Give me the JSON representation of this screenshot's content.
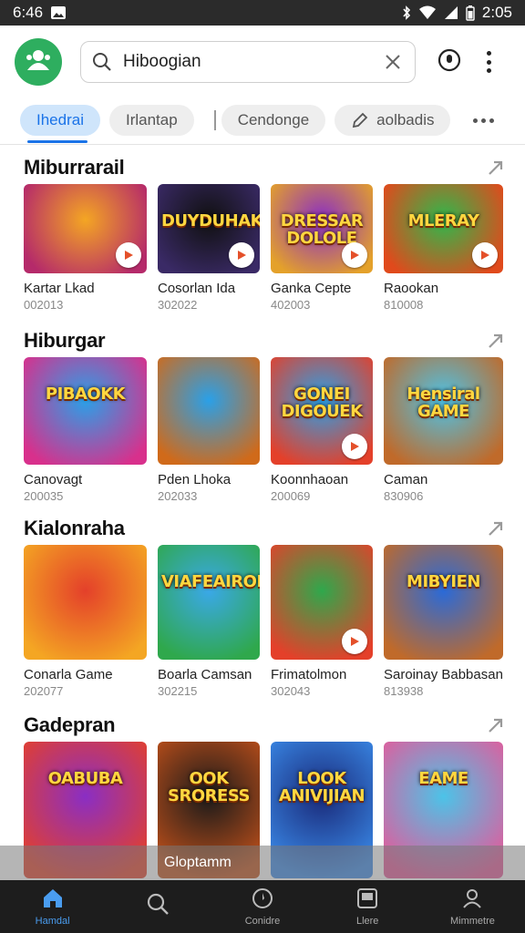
{
  "status": {
    "time_left": "6:46",
    "time_right": "2:05"
  },
  "search": {
    "value": "Hiboogian"
  },
  "chips": [
    {
      "label": "Ihedrai"
    },
    {
      "label": "Irlantap"
    },
    {
      "label": "Cendonge"
    },
    {
      "label": "aolbadis"
    }
  ],
  "sections": [
    {
      "title": "Miburrarail",
      "cards": [
        {
          "title": "Kartar Lkad",
          "sub": "002013",
          "art": "",
          "c1": "#f4a623",
          "c2": "#b52a6a"
        },
        {
          "title": "Cosorlan Ida",
          "sub": "302022",
          "art": "DUYDUHAK",
          "c1": "#101010",
          "c2": "#3a2a66"
        },
        {
          "title": "Ganka Cepte",
          "sub": "402003",
          "art": "DRESSAR DOLOLE",
          "c1": "#8a2ec4",
          "c2": "#e4a12a"
        },
        {
          "title": "Raookan",
          "sub": "810008",
          "art": "MLERAY",
          "c1": "#2fb84c",
          "c2": "#e04a1c"
        }
      ]
    },
    {
      "title": "Hiburgar",
      "cards": [
        {
          "title": "Canovagt",
          "sub": "200035",
          "art": "PIBAOKK",
          "c1": "#2aa0e8",
          "c2": "#d8308c"
        },
        {
          "title": "Pden Lhoka",
          "sub": "202033",
          "art": "",
          "c1": "#2aa0e8",
          "c2": "#d06a1a"
        },
        {
          "title": "Koonnhaoan",
          "sub": "200069",
          "art": "GONEI DIGOUEK",
          "c1": "#2aa0e8",
          "c2": "#e4402a"
        },
        {
          "title": "Caman",
          "sub": "830906",
          "art": "Hensiral GAME",
          "c1": "#4cc3e8",
          "c2": "#c06a2a"
        }
      ]
    },
    {
      "title": "Kialonraha",
      "cards": [
        {
          "title": "Conarla Game",
          "sub": "202077",
          "art": "",
          "c1": "#e4402a",
          "c2": "#f4a623"
        },
        {
          "title": "Boarla Camsan",
          "sub": "302215",
          "art": "VIAFEAIRODO",
          "c1": "#3aa8e8",
          "c2": "#2fa84c"
        },
        {
          "title": "Frimatolmon",
          "sub": "302043",
          "art": "",
          "c1": "#2fa84c",
          "c2": "#e4402a"
        },
        {
          "title": "Saroinay Babbasan",
          "sub": "813938",
          "art": "MIBYIEN",
          "c1": "#2a6ad8",
          "c2": "#c06a2a"
        }
      ]
    },
    {
      "title": "Gadepran",
      "cards": [
        {
          "title": "",
          "sub": "",
          "art": "OABUBA",
          "c1": "#8a2ec4",
          "c2": "#e4402a"
        },
        {
          "title": "",
          "sub": "",
          "art": "OOK SRORESS",
          "c1": "#1a1a1a",
          "c2": "#c0501a"
        },
        {
          "title": "",
          "sub": "",
          "art": "LOOK ANIVIJIAN",
          "c1": "#1a2a7a",
          "c2": "#3a8ae8"
        },
        {
          "title": "",
          "sub": "",
          "art": "EAME",
          "c1": "#4cc3e8",
          "c2": "#e45a9a"
        }
      ]
    }
  ],
  "toast": {
    "text": "Gloptamm"
  },
  "nav": [
    {
      "label": "Hamdal",
      "icon": "home-icon"
    },
    {
      "label": "",
      "icon": "search-icon"
    },
    {
      "label": "Conidre",
      "icon": "compass-icon"
    },
    {
      "label": "Llere",
      "icon": "library-icon"
    },
    {
      "label": "Mimmetre",
      "icon": "profile-icon"
    }
  ]
}
